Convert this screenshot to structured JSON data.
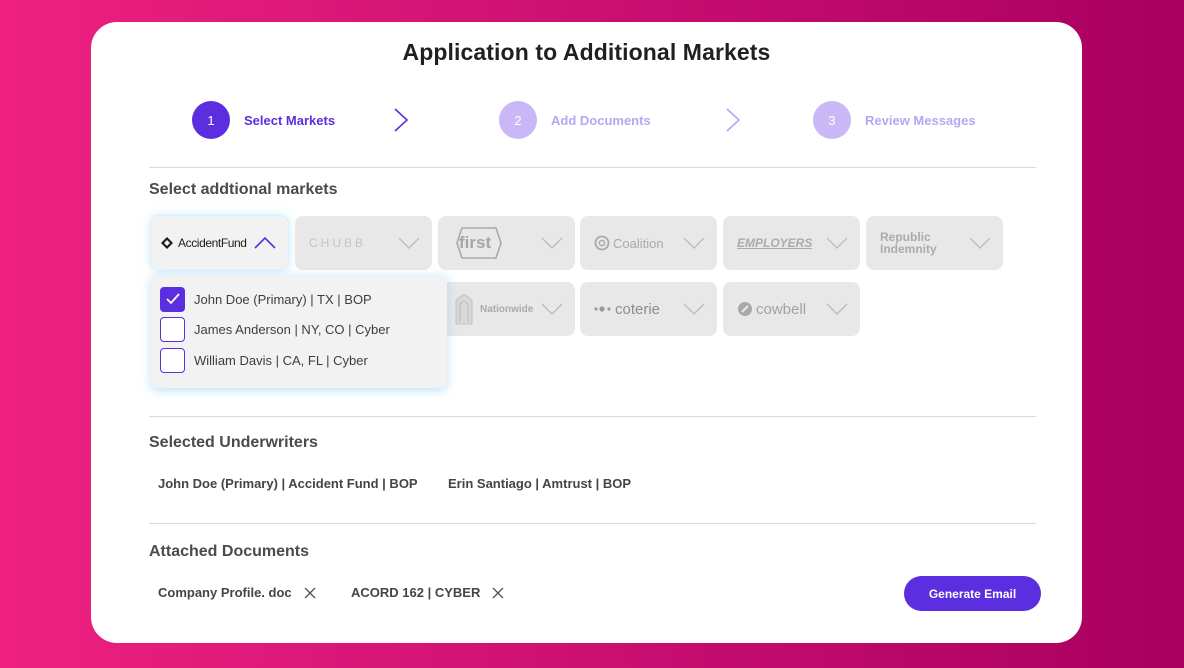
{
  "title": "Application to Additional Markets",
  "steps": [
    {
      "number": "1",
      "label": "Select Markets"
    },
    {
      "number": "2",
      "label": "Add Documents"
    },
    {
      "number": "3",
      "label": "Review Messages"
    }
  ],
  "markets_section": {
    "title": "Select addtional markets",
    "markets": [
      {
        "name": "AccidentFund"
      },
      {
        "name": "CHUBB"
      },
      {
        "name": "first"
      },
      {
        "name": "Coalition"
      },
      {
        "name": "EMPLOYERS"
      },
      {
        "name_line1": "Republic",
        "name_line2": "Indemnity"
      },
      {
        "name": "Nationwide"
      },
      {
        "name": "coterie"
      },
      {
        "name": "cowbell"
      }
    ],
    "dropdown_items": [
      {
        "label": "John Doe (Primary) | TX | BOP",
        "checked": true
      },
      {
        "label": "James Anderson | NY, CO | Cyber",
        "checked": false
      },
      {
        "label": "William Davis | CA, FL | Cyber",
        "checked": false
      }
    ]
  },
  "underwriters_section": {
    "title": "Selected Underwriters",
    "items": [
      "John Doe (Primary) | Accident Fund | BOP",
      "Erin Santiago | Amtrust | BOP"
    ]
  },
  "documents_section": {
    "title": "Attached Documents",
    "items": [
      "Company Profile. doc",
      "ACORD 162 | CYBER"
    ]
  },
  "generate_button": "Generate Email",
  "colors": {
    "accent": "#5b2ee0",
    "accent_light": "#c9b8f5",
    "bg_gradient_start": "#ee2180",
    "bg_gradient_end": "#a8005e"
  }
}
